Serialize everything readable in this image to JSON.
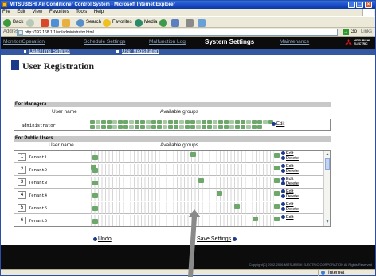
{
  "window": {
    "title": "MITSUBISHI Air Conditioner Control System - Microsoft Internet Explorer"
  },
  "menubar": [
    "File",
    "Edit",
    "View",
    "Favorites",
    "Tools",
    "Help"
  ],
  "toolbar": {
    "back": "Back",
    "search": "Search",
    "favorites": "Favorites",
    "media": "Media"
  },
  "address": {
    "label": "Address",
    "url": "http://192.168.1.1/en/administrator.html",
    "go": "Go",
    "links": "Links"
  },
  "nav": {
    "items": [
      "Monitor/Operation",
      "Schedule Settings",
      "Malfunction Log",
      "System Settings",
      "Maintenance"
    ],
    "active": "System Settings",
    "logo_lines": [
      "MITSUBISHI",
      "ELECTRIC"
    ]
  },
  "subnav": [
    "Date/Time Settings",
    "User Registration"
  ],
  "page_title": "User Registration",
  "managers": {
    "section": "For Managers",
    "col_user": "User name",
    "col_groups": "Available groups",
    "user": "administrator",
    "edit": "Edit"
  },
  "public": {
    "section": "For Public Users",
    "col_user": "User name",
    "col_groups": "Available groups",
    "rows": [
      {
        "num": "1",
        "name": "Tenant1",
        "edit": "Edit",
        "delete": "Delete"
      },
      {
        "num": "2",
        "name": "Tenant2",
        "edit": "Edit",
        "delete": "Delete"
      },
      {
        "num": "3",
        "name": "Tenant3",
        "edit": "Edit",
        "delete": "Delete"
      },
      {
        "num": "4",
        "name": "Tenant4",
        "edit": "Edit",
        "delete": "Delete"
      },
      {
        "num": "5",
        "name": "Tenant5",
        "edit": "Edit",
        "delete": "Delete"
      },
      {
        "num": "6",
        "name": "Tenant6",
        "edit": "Edit",
        "delete": ""
      }
    ]
  },
  "actions": {
    "undo": "Undo",
    "save": "Save Settings"
  },
  "footer": {
    "copyright": "Copyright(C) 2002-2006 MITSUBISHI ELECTRIC CORPORATION All Rights Reserved"
  },
  "status": {
    "zone": "Internet"
  },
  "colors": {
    "nav_bg": "#0c0c0c",
    "subnav_bg": "#3357a0",
    "accent": "#1d3a8a",
    "group_icon": "#6da86a"
  }
}
